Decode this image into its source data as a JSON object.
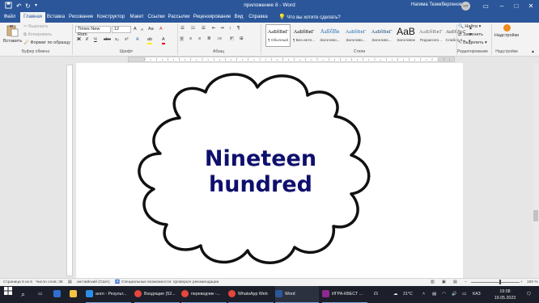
{
  "titlebar": {
    "document_title": "приложение 8  -  Word",
    "user_name": "Нагима Тезекбергенова",
    "user_initials": "НТ",
    "quick_access": [
      "save-icon",
      "undo-icon",
      "redo-icon",
      "customize-icon"
    ],
    "window_buttons": [
      "ribbon-display-icon",
      "minimize-icon",
      "maximize-icon",
      "close-icon"
    ]
  },
  "tabs": {
    "items": [
      "Файл",
      "Главная",
      "Вставка",
      "Рисование",
      "Конструктор",
      "Макет",
      "Ссылки",
      "Рассылки",
      "Рецензирование",
      "Вид",
      "Справка"
    ],
    "active": "Главная",
    "tell_me": "Что вы хотите сделать?"
  },
  "ribbon": {
    "clipboard": {
      "label": "Буфер обмена",
      "paste": "Вставить",
      "cut": "Вырезать",
      "copy": "Копировать",
      "format_painter": "Формат по образцу"
    },
    "font": {
      "label": "Шрифт",
      "font_name": "Times New Rom",
      "font_size": "12",
      "bold": "Ж",
      "italic": "К",
      "underline": "Ч",
      "strike": "abc",
      "subscript": "x₂",
      "superscript": "x²",
      "grow": "A",
      "shrink": "A",
      "case": "Aa",
      "clear": "A",
      "text_effects": "A",
      "highlight": "ab",
      "font_color": "A"
    },
    "paragraph": {
      "label": "Абзац"
    },
    "styles": {
      "label": "Стили",
      "items": [
        {
          "preview": "АаБбВвГ",
          "name": "¶ Обычный",
          "selected": true
        },
        {
          "preview": "АаБбВвГ",
          "name": "¶ Без инте..."
        },
        {
          "preview": "АаБбВв",
          "name": "Заголово..."
        },
        {
          "preview": "АаБбВвГ",
          "name": "Заголово..."
        },
        {
          "preview": "АаБбВвГ",
          "name": "Заголово..."
        },
        {
          "preview": "АаВ",
          "name": "Заголовок"
        },
        {
          "preview": "АаБбВвГ",
          "name": "Подзаголо..."
        },
        {
          "preview": "АаБбВеГ",
          "name": "Слабое в..."
        }
      ]
    },
    "editing": {
      "label": "Редактирование",
      "find": "Найти",
      "replace": "Заменить",
      "select": "Выделить"
    },
    "addins": {
      "label": "Надстройки",
      "addins": "Надстройки"
    }
  },
  "document": {
    "cloud_text_line1": "Nineteen",
    "cloud_text_line2": "hundred"
  },
  "statusbar": {
    "page": "Страница 5 из 6",
    "words": "Число слов: 38",
    "language": "английский (США)",
    "accessibility": "Специальные возможности: проверьте рекомендации",
    "zoom": "100 %"
  },
  "taskbar": {
    "items": [
      {
        "label": "",
        "icon": "windows-icon"
      },
      {
        "label": "",
        "icon": "search-icon"
      },
      {
        "label": "",
        "icon": "task-view-icon"
      },
      {
        "label": "",
        "icon": "widgets-icon"
      },
      {
        "label": "",
        "icon": "file-explorer-icon"
      },
      {
        "label": "англ - Результ...",
        "icon": "browser-icon"
      },
      {
        "label": "Входящие (52...",
        "icon": "chrome-icon"
      },
      {
        "label": "переводчик -...",
        "icon": "chrome-icon"
      },
      {
        "label": "WhatsApp Web",
        "icon": "chrome-icon"
      },
      {
        "label": "Word",
        "icon": "word-icon"
      },
      {
        "label": "ИГРА-КВЕСТ ...",
        "icon": "winrar-icon"
      }
    ],
    "weather": "21°C",
    "language": "КАЗ",
    "time": "19:08",
    "date": "19.05.2023"
  },
  "colors": {
    "word_blue": "#2b579a",
    "cloud_text": "#0f0f6e"
  }
}
